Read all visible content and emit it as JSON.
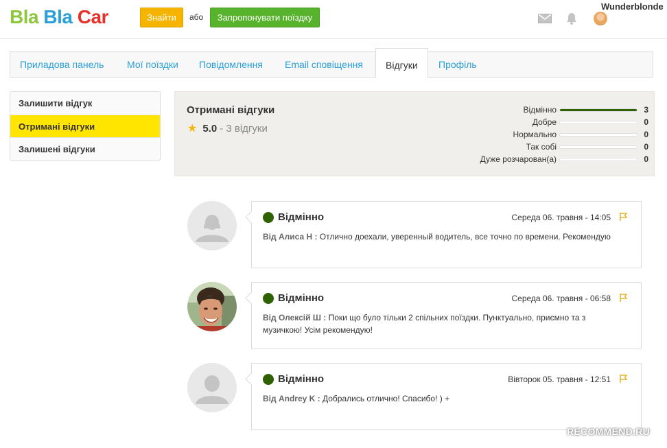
{
  "header": {
    "logo": {
      "w1": "Bla",
      "w2": "Bla",
      "w3": "Car"
    },
    "find_button": "Знайти",
    "or_text": "або",
    "offer_button": "Запропонувати поїздку",
    "username": "Wunderblonde"
  },
  "tabs": [
    {
      "label": "Приладова панель"
    },
    {
      "label": "Мої поїздки"
    },
    {
      "label": "Повідомлення"
    },
    {
      "label": "Email сповіщення"
    },
    {
      "label": "Відгуки"
    },
    {
      "label": "Профіль"
    }
  ],
  "sidebar": {
    "items": [
      {
        "label": "Залишити відгук"
      },
      {
        "label": "Отримані відгуки"
      },
      {
        "label": "Залишені відгуки"
      }
    ]
  },
  "summary": {
    "title": "Отримані відгуки",
    "score": "5.0",
    "count_text": "- 3 відгуки",
    "breakdown": [
      {
        "label": "Відмінно",
        "count": "3",
        "fill": 1.0
      },
      {
        "label": "Добре",
        "count": "0",
        "fill": 0
      },
      {
        "label": "Нормально",
        "count": "0",
        "fill": 0
      },
      {
        "label": "Так собі",
        "count": "0",
        "fill": 0
      },
      {
        "label": "Дуже розчарован(а)",
        "count": "0",
        "fill": 0
      }
    ]
  },
  "reviews": [
    {
      "rating": "Відмінно",
      "date": "Середа 06. травня - 14:05",
      "author": "Від Алиса Н :",
      "text": "Отлично доехали, уверенный водитель, все точно по времени. Рекомендую",
      "avatar": "default"
    },
    {
      "rating": "Відмінно",
      "date": "Середа 06. травня - 06:58",
      "author": "Від Олексій Ш :",
      "text": "Поки що було тільки 2 спільних поїздки. Пунктуально, приємно та з музичкою! Усім рекомендую!",
      "avatar": "photo"
    },
    {
      "rating": "Відмінно",
      "date": "Вівторок 05. травня - 12:51",
      "author": "Від Andrey K :",
      "text": "Добрались отлично! Спасибо! ) +",
      "avatar": "default"
    }
  ],
  "watermark": "RECOMMEND.RU",
  "colors": {
    "accent_yellow": "#ffe500",
    "brand_blue": "#2a9fd8",
    "rating_green": "#2e6200",
    "find_orange": "#f5b400",
    "offer_green": "#57b32b"
  }
}
